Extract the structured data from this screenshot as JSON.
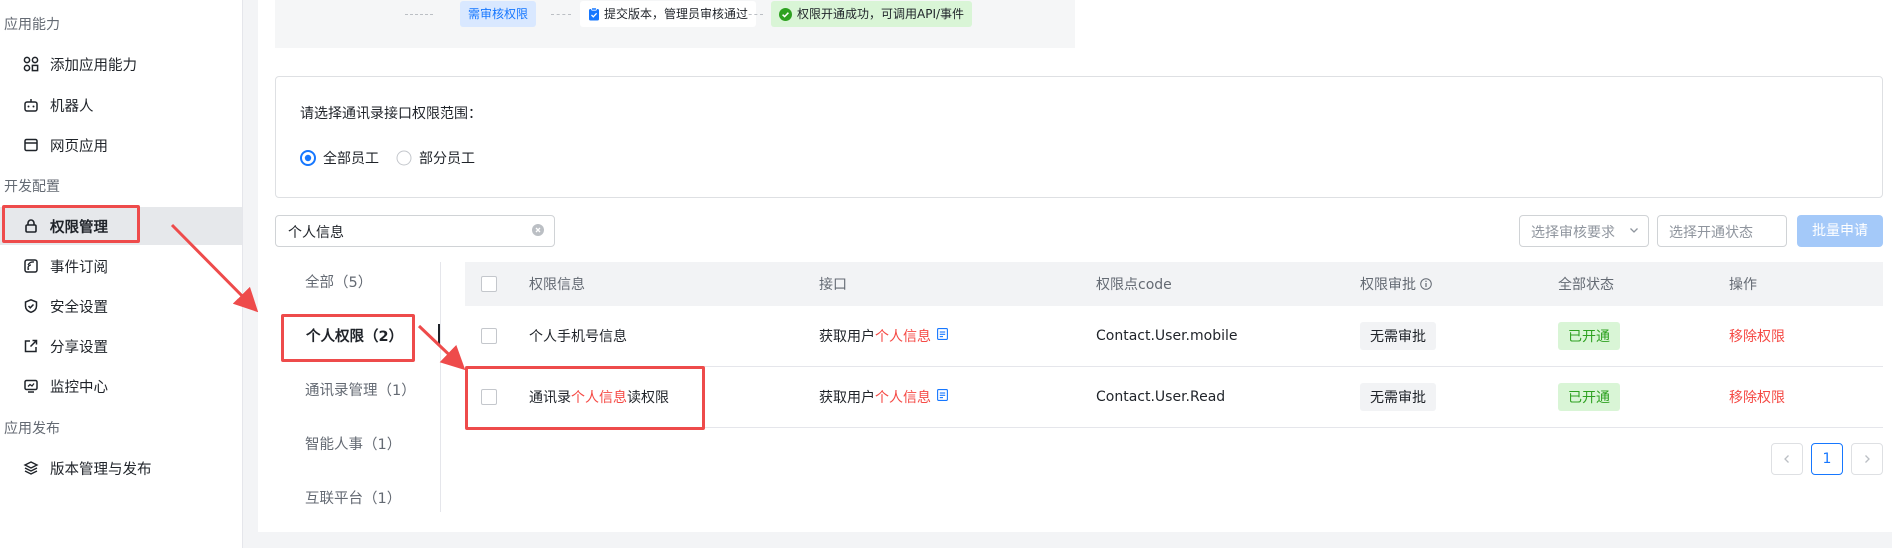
{
  "sidebar": {
    "sections": [
      {
        "title": "应用能力",
        "items": [
          {
            "label": "添加应用能力",
            "icon": "apps-icon"
          },
          {
            "label": "机器人",
            "icon": "robot-icon"
          },
          {
            "label": "网页应用",
            "icon": "web-app-icon"
          }
        ]
      },
      {
        "title": "开发配置",
        "items": [
          {
            "label": "权限管理",
            "icon": "lock-icon"
          },
          {
            "label": "事件订阅",
            "icon": "event-subscription-icon"
          },
          {
            "label": "安全设置",
            "icon": "shield-icon"
          },
          {
            "label": "分享设置",
            "icon": "share-icon"
          },
          {
            "label": "监控中心",
            "icon": "monitor-icon"
          }
        ]
      },
      {
        "title": "应用发布",
        "items": [
          {
            "label": "版本管理与发布",
            "icon": "layers-icon"
          }
        ]
      }
    ],
    "active_item": "权限管理"
  },
  "flow": {
    "step_review": "需审核权限",
    "step_submit": "提交版本，管理员审核通过",
    "step_success": "权限开通成功，可调用API/事件"
  },
  "scope": {
    "title": "请选择通讯录接口权限范围：",
    "options": [
      "全部员工",
      "部分员工"
    ],
    "selected": "全部员工"
  },
  "search": {
    "value": "个人信息"
  },
  "filters": {
    "review_placeholder": "选择审核要求",
    "status_placeholder": "选择开通状态",
    "batch_button": "批量申请"
  },
  "categories": [
    {
      "label": "全部（5）"
    },
    {
      "label": "个人权限（2）"
    },
    {
      "label": "通讯录管理（1）"
    },
    {
      "label": "智能人事（1）"
    },
    {
      "label": "互联平台（1）"
    }
  ],
  "table": {
    "headers": [
      "权限信息",
      "接口",
      "权限点code",
      "权限审批",
      "全部状态",
      "操作"
    ],
    "rows": [
      {
        "info": "个人手机号信息",
        "info_pre": "",
        "info_hl": "",
        "info_post": "",
        "api_pre": "获取用户",
        "api_hl": "个人信息",
        "code": "Contact.User.mobile",
        "approval": "无需审批",
        "status": "已开通",
        "action": "移除权限"
      },
      {
        "info": "",
        "info_pre": "通讯录",
        "info_hl": "个人信息",
        "info_post": "读权限",
        "api_pre": "获取用户",
        "api_hl": "个人信息",
        "code": "Contact.User.Read",
        "approval": "无需审批",
        "status": "已开通",
        "action": "移除权限"
      }
    ]
  },
  "pagination": {
    "current": "1"
  },
  "colors": {
    "primary": "#1677ff",
    "highlight": "#f54a45",
    "success": "#2ea121",
    "annotation": "#ee4b4b"
  }
}
